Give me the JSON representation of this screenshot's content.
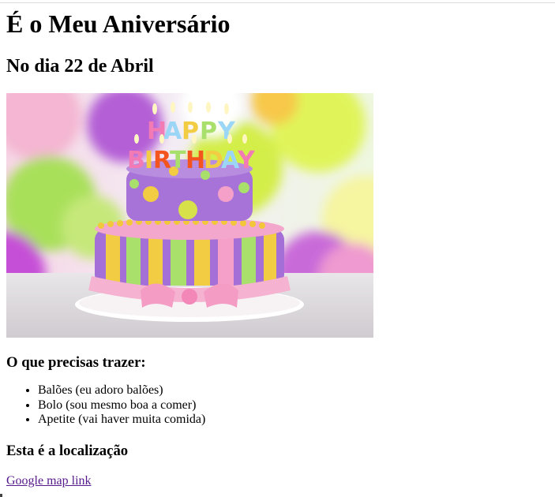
{
  "page": {
    "title": "É o Meu Aniversário",
    "subtitle": "No dia 22 de Abril"
  },
  "image": {
    "cake_topper": "HAPPY BIRTHDAY"
  },
  "bring": {
    "heading": "O que precisas trazer:",
    "items": [
      "Balões (eu adoro balões)",
      "Bolo (sou mesmo boa a comer)",
      "Apetite (vai haver muita comida)"
    ]
  },
  "location": {
    "heading": "Esta é a localização",
    "link_label": "Google map link"
  },
  "colors": {
    "link_visited": "#551a8b",
    "text": "#000000"
  }
}
